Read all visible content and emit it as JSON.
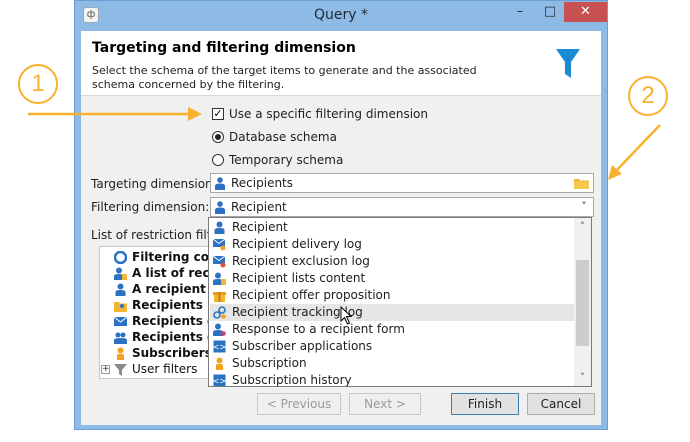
{
  "window": {
    "title": "Query *",
    "app_icon_glyph": "ф",
    "minimize_glyph": "–",
    "maximize_glyph": "□",
    "close_glyph": "✕"
  },
  "header": {
    "title": "Targeting and filtering dimension",
    "description": "Select the schema of the target items to  generate and the associated schema concerned by the filtering."
  },
  "options": {
    "use_specific_label": "Use a specific filtering dimension",
    "use_specific_checked": true,
    "database_schema_label": "Database schema",
    "database_schema_selected": true,
    "temporary_schema_label": "Temporary schema",
    "temporary_schema_selected": false
  },
  "fields": {
    "targeting_label": "Targeting dimension:",
    "targeting_value": "Recipients",
    "filtering_label": "Filtering dimension:",
    "filtering_value": "Recipient"
  },
  "restriction": {
    "label": "List of restriction filters",
    "items": [
      {
        "label": "Filtering cond",
        "icon": "filter-conditions-icon"
      },
      {
        "label": "A list of recipi",
        "icon": "recipient-list-icon"
      },
      {
        "label": "A recipient",
        "icon": "person-icon"
      },
      {
        "label": "Recipients inc",
        "icon": "folder-person-icon"
      },
      {
        "label": "Recipients of",
        "icon": "envelope-icon"
      },
      {
        "label": "Recipients of",
        "icon": "recipients-icon"
      },
      {
        "label": "Subscribers of",
        "icon": "subscriber-icon"
      },
      {
        "label": "User filters",
        "icon": "funnel-icon"
      }
    ],
    "expander_glyph": "+"
  },
  "dropdown": {
    "items": [
      {
        "label": "Recipient",
        "icon": "person-icon",
        "selected": false
      },
      {
        "label": "Recipient delivery log",
        "icon": "envelope-person-icon",
        "selected": false
      },
      {
        "label": "Recipient exclusion log",
        "icon": "envelope-exclusion-icon",
        "selected": false
      },
      {
        "label": "Recipient lists content",
        "icon": "recipient-list-icon",
        "selected": false
      },
      {
        "label": "Recipient offer proposition",
        "icon": "gift-icon",
        "selected": false
      },
      {
        "label": "Recipient tracking log",
        "icon": "link-icon",
        "selected": true
      },
      {
        "label": "Response to a recipient form",
        "icon": "form-response-icon",
        "selected": false
      },
      {
        "label": "Subscriber applications",
        "icon": "app-icon",
        "selected": false
      },
      {
        "label": "Subscription",
        "icon": "subscription-icon",
        "selected": false
      },
      {
        "label": "Subscription history",
        "icon": "subscription-history-icon",
        "selected": false
      }
    ],
    "scroll_up_glyph": "˄",
    "scroll_down_glyph": "˅"
  },
  "buttons": {
    "previous": "< Previous",
    "next": "Next >",
    "finish": "Finish",
    "cancel": "Cancel"
  },
  "callouts": {
    "one": "1",
    "two": "2"
  },
  "colors": {
    "window_frame": "#8dbbe6",
    "accent_orange": "#f7b12e",
    "icon_blue": "#2b73c2",
    "funnel_blue": "#1a8ad4"
  }
}
